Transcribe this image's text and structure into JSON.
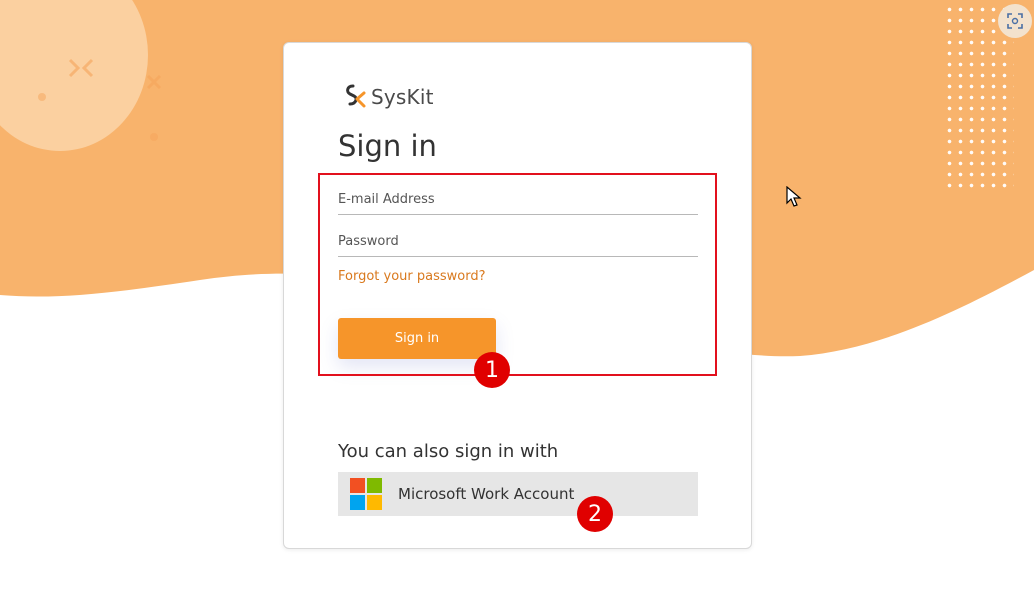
{
  "brand": {
    "name": "SysKit",
    "accent_color": "#f6952a",
    "link_color": "#d9791e"
  },
  "login": {
    "title": "Sign in",
    "email_placeholder": "E-mail Address",
    "password_placeholder": "Password",
    "forgot_link": "Forgot your password?",
    "submit_label": "Sign in"
  },
  "alt_signin": {
    "heading": "You can also sign in with",
    "microsoft_label": "Microsoft Work Account"
  },
  "annotations": {
    "badge_1": "1",
    "badge_2": "2",
    "highlight_color": "#e2101d"
  },
  "icons": [
    "syskit-logo-icon",
    "microsoft-logo-icon",
    "screenshot-capture-icon",
    "mouse-cursor-icon"
  ]
}
